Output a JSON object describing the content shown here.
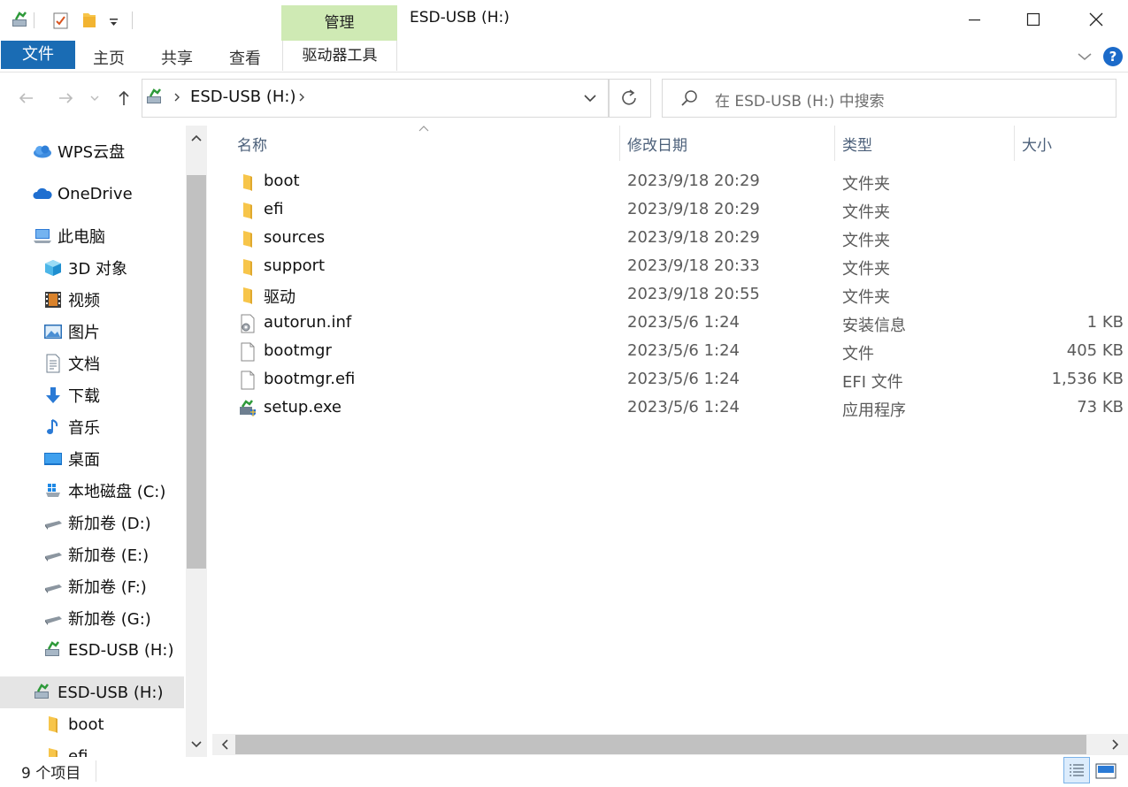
{
  "window": {
    "title": "ESD-USB (H:)",
    "contextual_tab_group": "管理",
    "minimize": "minimize",
    "maximize": "maximize",
    "close": "close"
  },
  "ribbon": {
    "tabs": [
      "文件",
      "主页",
      "共享",
      "查看",
      "驱动器工具"
    ]
  },
  "address": {
    "crumbs": [
      "ESD-USB (H:)"
    ],
    "search_placeholder": "在 ESD-USB (H:) 中搜索"
  },
  "nav": {
    "wps": "WPS云盘",
    "onedrive": "OneDrive",
    "this_pc": "此电脑",
    "objects3d": "3D 对象",
    "videos": "视频",
    "pictures": "图片",
    "documents": "文档",
    "downloads": "下载",
    "music": "音乐",
    "desktop": "桌面",
    "drive_c": "本地磁盘 (C:)",
    "drive_d": "新加卷 (D:)",
    "drive_e": "新加卷 (E:)",
    "drive_f": "新加卷 (F:)",
    "drive_g": "新加卷 (G:)",
    "drive_h": "ESD-USB (H:)",
    "usb_root": "ESD-USB (H:)",
    "usb_boot": "boot",
    "usb_efi": "efi"
  },
  "columns": {
    "name": "名称",
    "date": "修改日期",
    "type": "类型",
    "size": "大小"
  },
  "files": [
    {
      "name": "boot",
      "date": "2023/9/18 20:29",
      "type": "文件夹",
      "size": "",
      "icon": "folder-icon"
    },
    {
      "name": "efi",
      "date": "2023/9/18 20:29",
      "type": "文件夹",
      "size": "",
      "icon": "folder-icon"
    },
    {
      "name": "sources",
      "date": "2023/9/18 20:29",
      "type": "文件夹",
      "size": "",
      "icon": "folder-icon"
    },
    {
      "name": "support",
      "date": "2023/9/18 20:33",
      "type": "文件夹",
      "size": "",
      "icon": "folder-icon"
    },
    {
      "name": "驱动",
      "date": "2023/9/18 20:55",
      "type": "文件夹",
      "size": "",
      "icon": "folder-icon"
    },
    {
      "name": "autorun.inf",
      "date": "2023/5/6 1:24",
      "type": "安装信息",
      "size": "1 KB",
      "icon": "settings-file-icon"
    },
    {
      "name": "bootmgr",
      "date": "2023/5/6 1:24",
      "type": "文件",
      "size": "405 KB",
      "icon": "file-icon"
    },
    {
      "name": "bootmgr.efi",
      "date": "2023/5/6 1:24",
      "type": "EFI 文件",
      "size": "1,536 KB",
      "icon": "file-icon"
    },
    {
      "name": "setup.exe",
      "date": "2023/5/6 1:24",
      "type": "应用程序",
      "size": "73 KB",
      "icon": "setup-exe-icon"
    }
  ],
  "status": {
    "count": "9 个项目"
  },
  "colors": {
    "file_tab": "#1a6cb4",
    "manage_tab": "#cfeab4",
    "folder": "#f7c54a",
    "help": "#1b6ac9"
  }
}
